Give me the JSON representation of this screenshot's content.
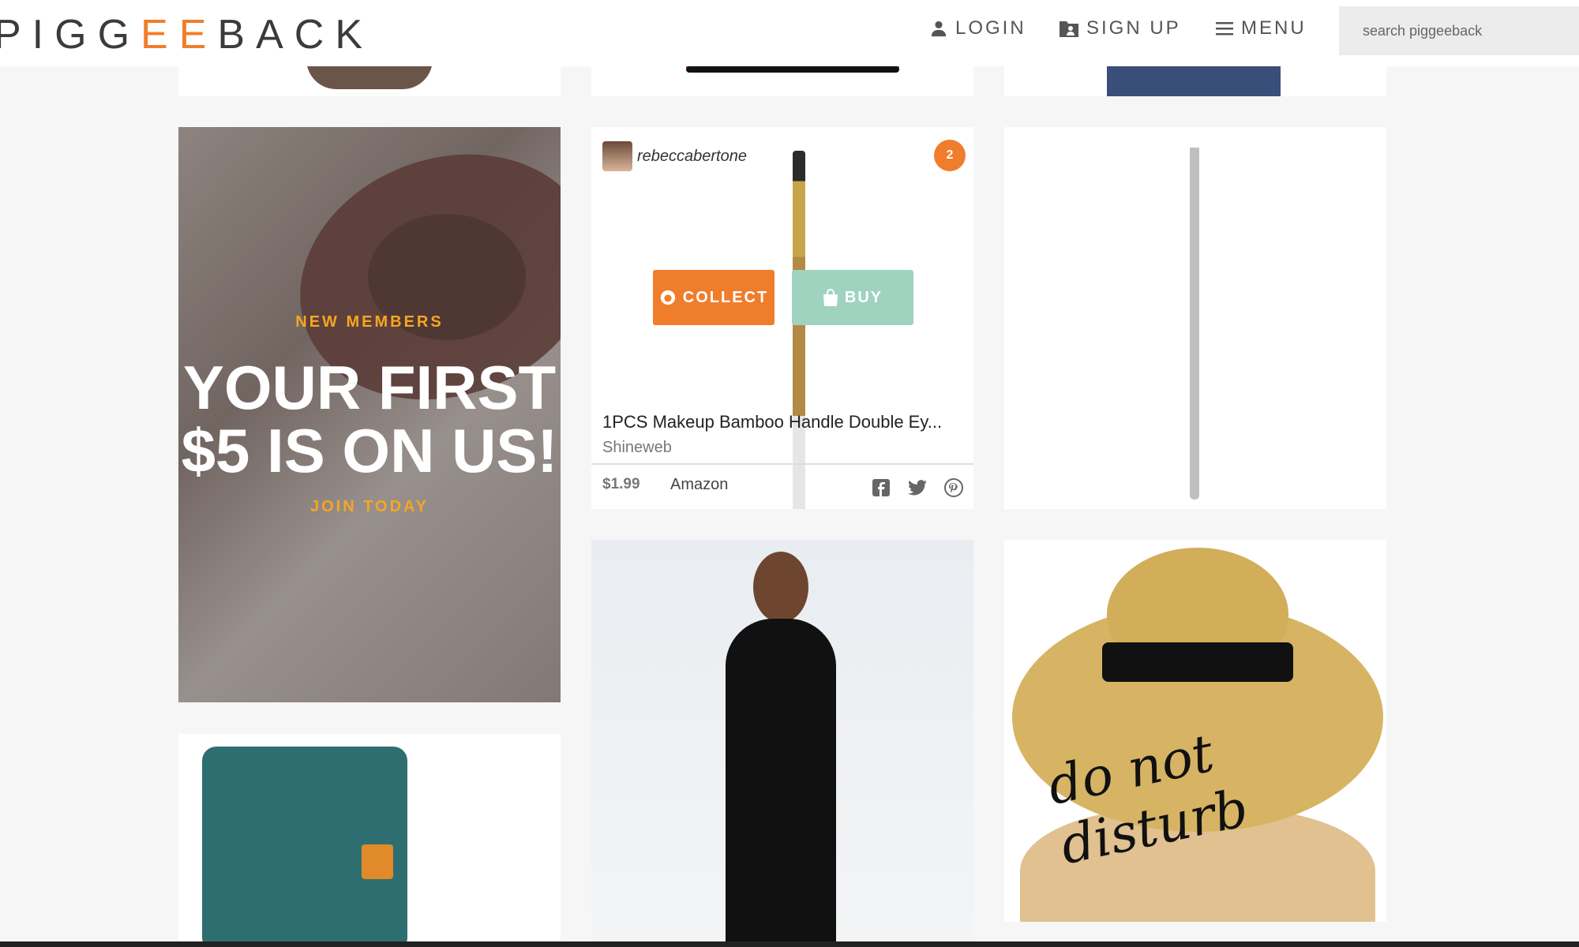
{
  "header": {
    "logo": {
      "part1": "PIGG",
      "accent": "EE",
      "part2": "BACK"
    },
    "login": "LOGIN",
    "signup": "SIGN UP",
    "menu": "MENU",
    "search_placeholder": "search piggeeback"
  },
  "promo": {
    "line1": "NEW MEMBERS",
    "line2a": "YOUR FIRST",
    "line2b": "$5 IS ON US!",
    "line3": "JOIN TODAY"
  },
  "product": {
    "username": "rebeccabertone",
    "collect_count": "2",
    "collect_label": "COLLECT",
    "buy_label": "BUY",
    "title": "1PCS Makeup Bamboo Handle Double Ey...",
    "brand": "Shineweb",
    "price": "$1.99",
    "store": "Amazon"
  },
  "strawhat": {
    "text": "do not disturb"
  },
  "colors": {
    "accent": "#f07d2b",
    "buy": "#9fd3bf",
    "promo_gold": "#f6a623"
  },
  "icons": [
    "user-icon",
    "signup-icon",
    "menu-icon",
    "piggy-icon",
    "bag-icon",
    "facebook-icon",
    "twitter-icon",
    "pinterest-icon"
  ]
}
